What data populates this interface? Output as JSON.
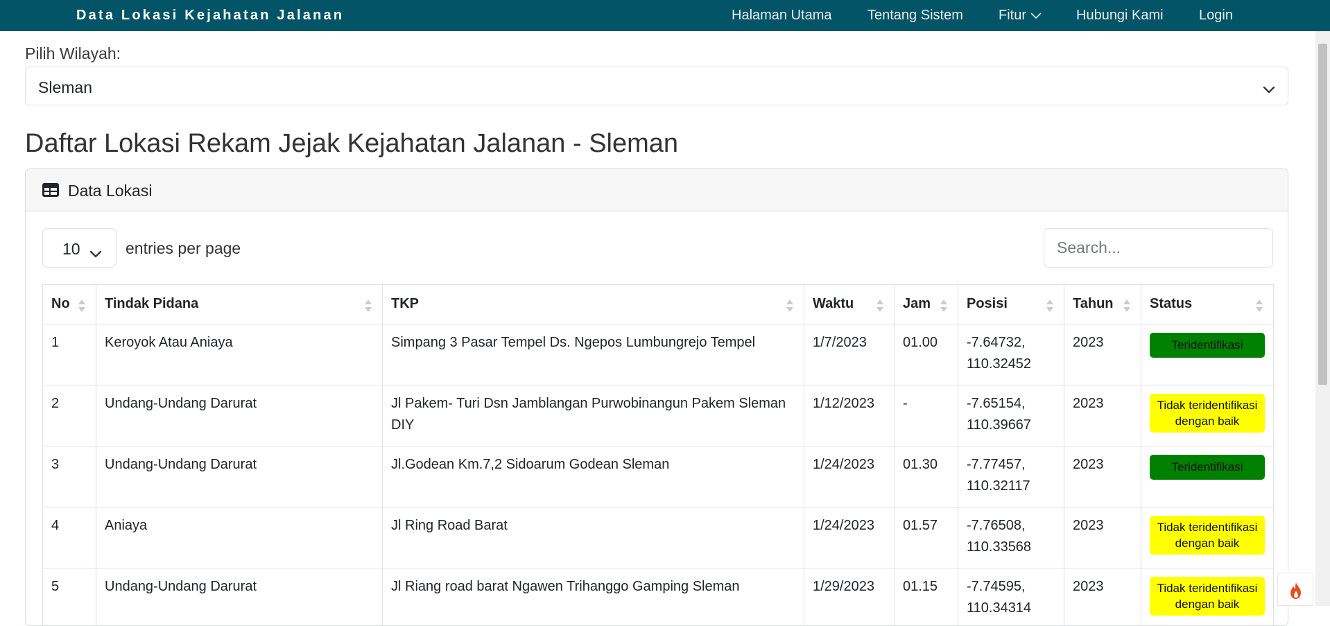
{
  "navbar": {
    "brand": "Data Lokasi Kejahatan Jalanan",
    "items": [
      {
        "label": "Halaman Utama"
      },
      {
        "label": "Tentang Sistem"
      },
      {
        "label": "Fitur"
      },
      {
        "label": "Hubungi Kami"
      },
      {
        "label": "Login"
      }
    ]
  },
  "region": {
    "label": "Pilih Wilayah:",
    "selected": "Sleman"
  },
  "page_title": "Daftar Lokasi Rekam Jejak Kejahatan Jalanan - Sleman",
  "card": {
    "title": "Data Lokasi"
  },
  "datatable": {
    "per_page_value": "10",
    "per_page_label": "entries per page",
    "search_placeholder": "Search...",
    "columns": [
      "No",
      "Tindak Pidana",
      "TKP",
      "Waktu",
      "Jam",
      "Posisi",
      "Tahun",
      "Status"
    ],
    "rows": [
      {
        "no": "1",
        "tindak_pidana": "Keroyok Atau Aniaya",
        "tkp": "Simpang 3 Pasar Tempel Ds. Ngepos Lumbungrejo Tempel",
        "waktu": "1/7/2023",
        "jam": "01.00",
        "posisi_lat": "-7.64732,",
        "posisi_lng": "110.32452",
        "tahun": "2023",
        "status": "Teridentifikasi",
        "status_type": "identified"
      },
      {
        "no": "2",
        "tindak_pidana": "Undang-Undang Darurat",
        "tkp": "Jl Pakem- Turi Dsn Jamblangan Purwobinangun Pakem Sleman DIY",
        "waktu": "1/12/2023",
        "jam": "-",
        "posisi_lat": "-7.65154,",
        "posisi_lng": "110.39667",
        "tahun": "2023",
        "status": "Tidak teridentifikasi dengan baik",
        "status_type": "unidentified"
      },
      {
        "no": "3",
        "tindak_pidana": "Undang-Undang Darurat",
        "tkp": "Jl.Godean Km.7,2 Sidoarum Godean Sleman",
        "waktu": "1/24/2023",
        "jam": "01.30",
        "posisi_lat": "-7.77457,",
        "posisi_lng": "110.32117",
        "tahun": "2023",
        "status": "Teridentifikasi",
        "status_type": "identified"
      },
      {
        "no": "4",
        "tindak_pidana": "Aniaya",
        "tkp": "Jl Ring Road Barat",
        "waktu": "1/24/2023",
        "jam": "01.57",
        "posisi_lat": "-7.76508,",
        "posisi_lng": "110.33568",
        "tahun": "2023",
        "status": "Tidak teridentifikasi dengan baik",
        "status_type": "unidentified"
      },
      {
        "no": "5",
        "tindak_pidana": "Undang-Undang Darurat",
        "tkp": "Jl Riang road barat Ngawen Trihanggo Gamping Sleman",
        "waktu": "1/29/2023",
        "jam": "01.15",
        "posisi_lat": "-7.74595,",
        "posisi_lng": "110.34314",
        "tahun": "2023",
        "status": "Tidak teridentifikasi dengan baik",
        "status_type": "unidentified"
      }
    ]
  },
  "colors": {
    "navbar_bg": "#035466",
    "identified_badge": "#008000",
    "unidentified_badge": "#ffff00",
    "fire_icon": "#e44d26"
  },
  "icons": {
    "card_header": "table-icon",
    "dropdown": "chevron-down-icon",
    "sort": "sort-arrows-icon",
    "floating": "fire-icon"
  }
}
